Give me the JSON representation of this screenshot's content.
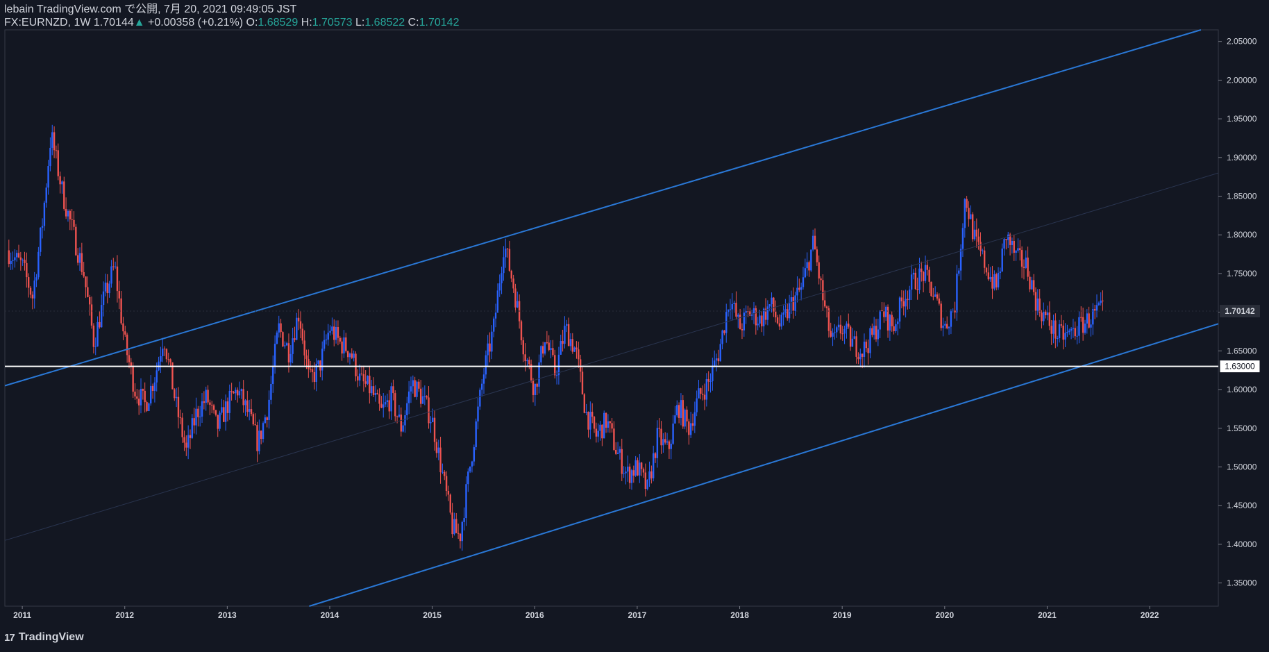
{
  "header": {
    "line1": "lebain TradingView.com で公開, 7月 20, 2021 09:49:05 JST",
    "symbol_label": "FX:EURNZD, 1W",
    "last": "1.70144",
    "change_arrow": "▲",
    "change": "+0.00358 (+0.21%)",
    "o_label": "O:",
    "o": "1.68529",
    "h_label": "H:",
    "h": "1.70573",
    "l_label": "L:",
    "l": "1.68522",
    "c_label": "C:",
    "c": "1.70142"
  },
  "footer": {
    "logo_icon": "17",
    "logo_text": "TradingView"
  },
  "colors": {
    "background": "#131722",
    "up": "#2962ff",
    "down": "#ef5350",
    "channel": "#2a78d6",
    "hline": "#ffffff"
  },
  "chart_data": {
    "type": "candlestick",
    "x_ticks": [
      "2011",
      "2012",
      "2013",
      "2014",
      "2015",
      "2016",
      "2017",
      "2018",
      "2019",
      "2020",
      "2021",
      "2022"
    ],
    "y_ticks": [
      "2.05000",
      "2.00000",
      "1.95000",
      "1.90000",
      "1.85000",
      "1.80000",
      "1.75000",
      "1.70000",
      "1.65000",
      "1.60000",
      "1.55000",
      "1.50000",
      "1.45000",
      "1.40000",
      "1.35000"
    ],
    "ylim": [
      1.32,
      2.065
    ],
    "xlim": [
      2010.83,
      2022.67
    ],
    "last_price_label": "1.70142",
    "last_price": 1.70142,
    "horizontal_line": {
      "value": 1.63,
      "label": "1.63000"
    },
    "channel_lines": [
      {
        "role": "upper",
        "from": [
          2010.83,
          1.605
        ],
        "to": [
          2022.5,
          2.065
        ]
      },
      {
        "role": "middle",
        "from": [
          2010.83,
          1.405
        ],
        "to": [
          2022.67,
          1.88
        ]
      },
      {
        "role": "lower",
        "from": [
          2013.8,
          1.32
        ],
        "to": [
          2022.67,
          1.685
        ]
      }
    ],
    "close_path": [
      [
        2010.85,
        1.78
      ],
      [
        2011.0,
        1.76
      ],
      [
        2011.1,
        1.72
      ],
      [
        2011.2,
        1.82
      ],
      [
        2011.28,
        1.93
      ],
      [
        2011.4,
        1.85
      ],
      [
        2011.5,
        1.8
      ],
      [
        2011.6,
        1.75
      ],
      [
        2011.7,
        1.66
      ],
      [
        2011.8,
        1.72
      ],
      [
        2011.9,
        1.76
      ],
      [
        2012.0,
        1.66
      ],
      [
        2012.1,
        1.6
      ],
      [
        2012.2,
        1.58
      ],
      [
        2012.3,
        1.62
      ],
      [
        2012.38,
        1.67
      ],
      [
        2012.5,
        1.58
      ],
      [
        2012.6,
        1.52
      ],
      [
        2012.7,
        1.57
      ],
      [
        2012.8,
        1.59
      ],
      [
        2012.9,
        1.55
      ],
      [
        2013.0,
        1.58
      ],
      [
        2013.1,
        1.6
      ],
      [
        2013.2,
        1.57
      ],
      [
        2013.3,
        1.53
      ],
      [
        2013.4,
        1.58
      ],
      [
        2013.5,
        1.68
      ],
      [
        2013.6,
        1.65
      ],
      [
        2013.7,
        1.7
      ],
      [
        2013.8,
        1.61
      ],
      [
        2013.9,
        1.63
      ],
      [
        2014.0,
        1.68
      ],
      [
        2014.1,
        1.66
      ],
      [
        2014.2,
        1.65
      ],
      [
        2014.3,
        1.61
      ],
      [
        2014.4,
        1.6
      ],
      [
        2014.5,
        1.57
      ],
      [
        2014.6,
        1.59
      ],
      [
        2014.7,
        1.55
      ],
      [
        2014.8,
        1.61
      ],
      [
        2014.9,
        1.59
      ],
      [
        2015.0,
        1.56
      ],
      [
        2015.1,
        1.49
      ],
      [
        2015.2,
        1.42
      ],
      [
        2015.27,
        1.41
      ],
      [
        2015.4,
        1.53
      ],
      [
        2015.5,
        1.62
      ],
      [
        2015.6,
        1.68
      ],
      [
        2015.7,
        1.79
      ],
      [
        2015.8,
        1.73
      ],
      [
        2015.9,
        1.65
      ],
      [
        2016.0,
        1.6
      ],
      [
        2016.1,
        1.67
      ],
      [
        2016.2,
        1.62
      ],
      [
        2016.3,
        1.68
      ],
      [
        2016.4,
        1.65
      ],
      [
        2016.5,
        1.57
      ],
      [
        2016.6,
        1.54
      ],
      [
        2016.7,
        1.56
      ],
      [
        2016.8,
        1.52
      ],
      [
        2016.9,
        1.49
      ],
      [
        2017.0,
        1.5
      ],
      [
        2017.1,
        1.47
      ],
      [
        2017.2,
        1.54
      ],
      [
        2017.3,
        1.52
      ],
      [
        2017.4,
        1.58
      ],
      [
        2017.5,
        1.55
      ],
      [
        2017.6,
        1.59
      ],
      [
        2017.7,
        1.61
      ],
      [
        2017.8,
        1.65
      ],
      [
        2017.9,
        1.72
      ],
      [
        2018.0,
        1.68
      ],
      [
        2018.1,
        1.7
      ],
      [
        2018.2,
        1.69
      ],
      [
        2018.3,
        1.71
      ],
      [
        2018.4,
        1.68
      ],
      [
        2018.5,
        1.71
      ],
      [
        2018.6,
        1.73
      ],
      [
        2018.72,
        1.79
      ],
      [
        2018.82,
        1.71
      ],
      [
        2018.9,
        1.66
      ],
      [
        2019.0,
        1.68
      ],
      [
        2019.1,
        1.66
      ],
      [
        2019.2,
        1.65
      ],
      [
        2019.3,
        1.67
      ],
      [
        2019.4,
        1.7
      ],
      [
        2019.5,
        1.68
      ],
      [
        2019.6,
        1.72
      ],
      [
        2019.7,
        1.74
      ],
      [
        2019.8,
        1.75
      ],
      [
        2019.9,
        1.72
      ],
      [
        2020.0,
        1.68
      ],
      [
        2020.1,
        1.71
      ],
      [
        2020.2,
        1.85
      ],
      [
        2020.3,
        1.79
      ],
      [
        2020.4,
        1.76
      ],
      [
        2020.5,
        1.73
      ],
      [
        2020.6,
        1.8
      ],
      [
        2020.7,
        1.77
      ],
      [
        2020.8,
        1.76
      ],
      [
        2020.9,
        1.71
      ],
      [
        2021.0,
        1.69
      ],
      [
        2021.1,
        1.67
      ],
      [
        2021.2,
        1.67
      ],
      [
        2021.3,
        1.68
      ],
      [
        2021.4,
        1.69
      ],
      [
        2021.5,
        1.7
      ],
      [
        2021.55,
        1.70142
      ]
    ]
  }
}
